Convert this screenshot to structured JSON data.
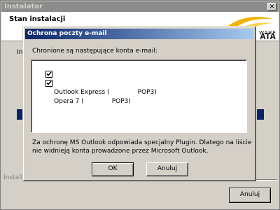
{
  "window": {
    "title": "Instalator",
    "close_symbol": "✕",
    "header_title": "Stan instalacji",
    "logo_text": "ATA",
    "logo_subtext": "WARE",
    "partial_label": "Insta",
    "installshield_label": "InstallSh",
    "cancel_label": "Anuluj"
  },
  "dialog": {
    "title": "Ochrona poczty e-mail",
    "prompt": "Chronione są następujące konta e-mail:",
    "accounts": [
      {
        "label": "Outlook Express (              POP3)",
        "checked": true
      },
      {
        "label": "Opera 7 (              POP3)",
        "checked": true
      }
    ],
    "note": "Za ochronę MS Outlook odpowiada specjalny Plugin. Dlatego na liście nie widnieją konta prowadzone przez Microsoft Outlook.",
    "ok_label": "OK",
    "cancel_label": "Anuluj"
  },
  "colors": {
    "titlebar_active": "#0a246a",
    "titlebar_gradient_end": "#a6caf0",
    "titlebar_inactive": "#8c8c8c",
    "logo_accent": "#f0b400"
  }
}
